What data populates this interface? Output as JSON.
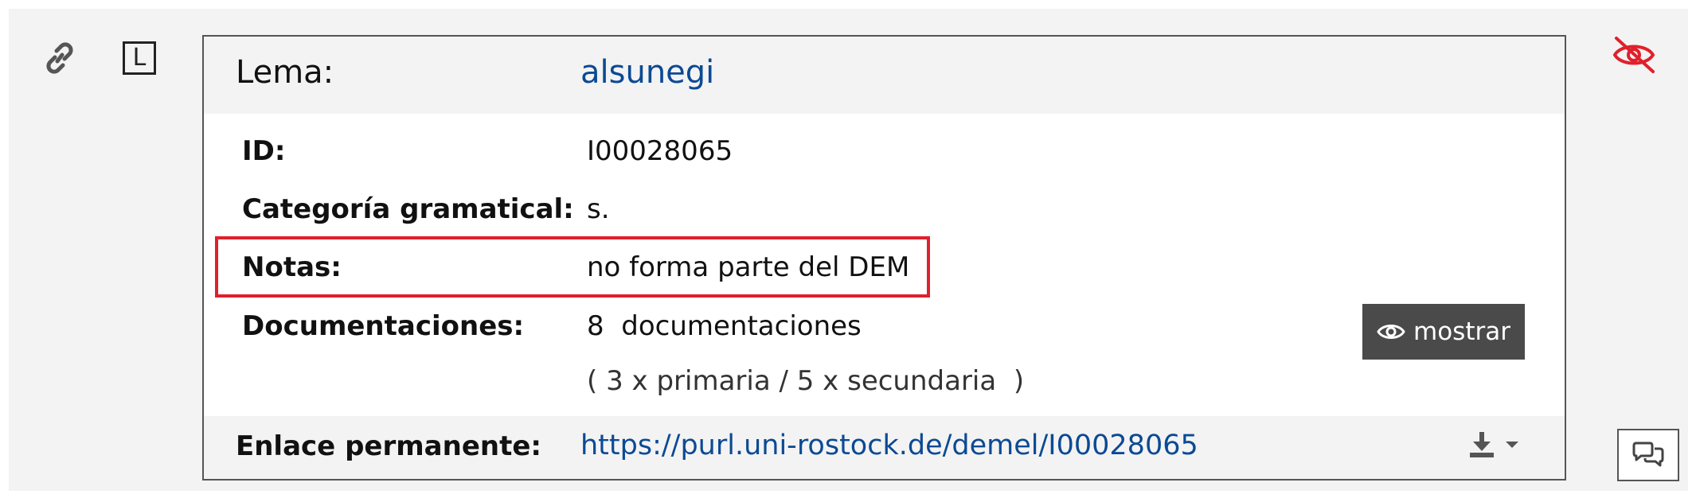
{
  "toolbar": {
    "link_icon": "link-icon",
    "layer_letter": "L",
    "hide_icon": "eye-slash-icon"
  },
  "entry": {
    "lema_label": "Lema:",
    "lema_value": "alsunegi",
    "id_label": "ID:",
    "id_value": "I00028065",
    "category_label": "Categoría gramatical:",
    "category_value": "s.",
    "notes_label": "Notas:",
    "notes_value": "no forma parte del DEM",
    "docs_label": "Documentaciones:",
    "docs_value": "8  documentaciones",
    "docs_breakdown": "( 3 x primaria / 5 x secundaria  )",
    "show_button_label": "mostrar",
    "permalink_label": "Enlace permanente:",
    "permalink_url": "https://purl.uni-rostock.de/demel/I00028065"
  },
  "colors": {
    "link": "#0b4a94",
    "highlight": "#e0202c",
    "hide_icon": "#e0202c",
    "button_bg": "#4a4a4a"
  }
}
